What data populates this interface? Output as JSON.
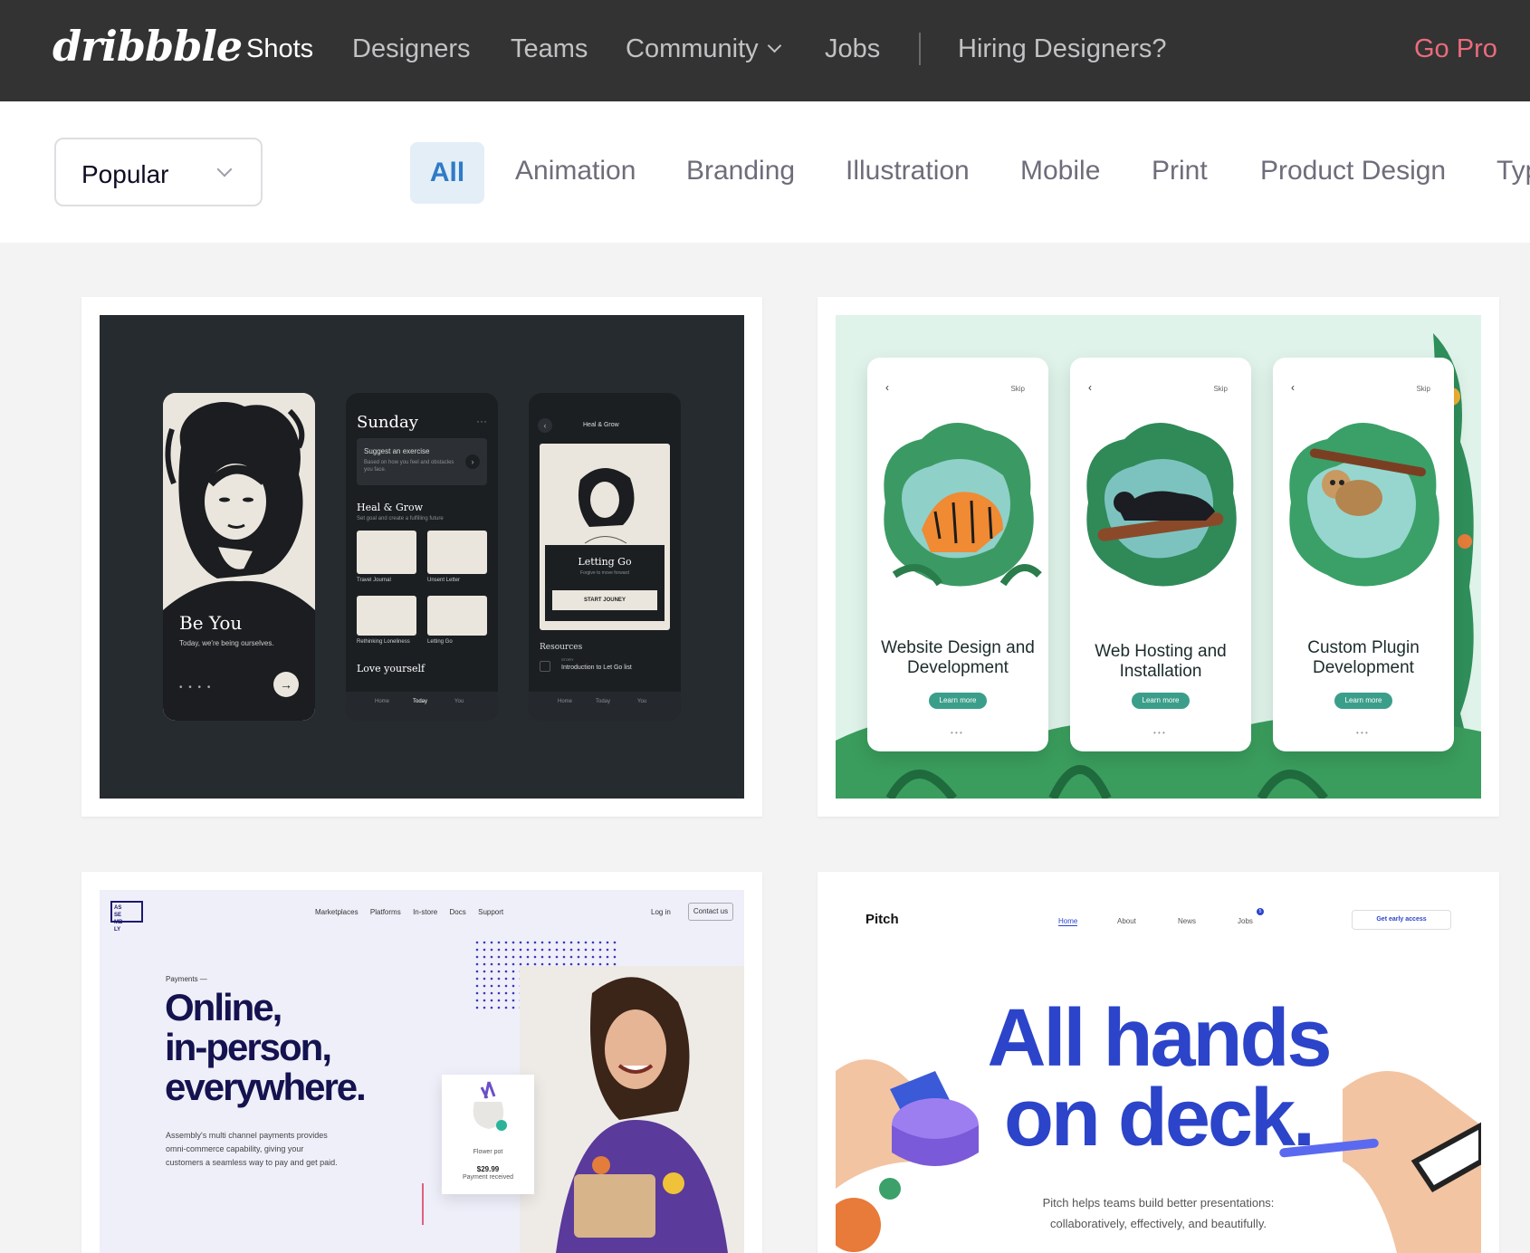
{
  "nav": {
    "logo": "dribbble",
    "links": [
      "Shots",
      "Designers",
      "Teams",
      "Community",
      "Jobs"
    ],
    "hiring": "Hiring Designers?",
    "go_pro": "Go Pro",
    "colors": {
      "background": "#333333",
      "go_pro": "#ea6c7c"
    }
  },
  "filter": {
    "sort": "Popular",
    "categories": [
      "All",
      "Animation",
      "Branding",
      "Illustration",
      "Mobile",
      "Print",
      "Product Design",
      "Typ"
    ],
    "active": "All"
  },
  "shots": [
    {
      "screens": {
        "be_you": {
          "title": "Be You",
          "subtitle": "Today, we're being ourselves."
        },
        "sunday": {
          "title": "Sunday",
          "card_title": "Suggest an exercise",
          "card_text": "Based on how you feel and obstacles you face.",
          "section": "Heal & Grow",
          "section_sub": "Set goal and create a fulfilling future",
          "items": [
            "Travel Journal",
            "Unsent Letter",
            "Rethinking Loneliness",
            "Letting Go"
          ],
          "footer_title": "Love yourself",
          "tabs": [
            "Home",
            "Today",
            "You"
          ]
        },
        "heal": {
          "header": "Heal & Grow",
          "card_title": "Letting Go",
          "card_sub": "Forgive to move forward",
          "button": "START JOUNEY",
          "resources": "Resources",
          "story": "STORY",
          "resource_item": "Introduction to Let Go list",
          "tabs": [
            "Home",
            "Today",
            "You"
          ]
        }
      }
    },
    {
      "screens": [
        {
          "title": "Website Design and Development",
          "button": "Learn more",
          "skip": "Skip"
        },
        {
          "title": "Web Hosting and Installation",
          "button": "Learn more",
          "skip": "Skip"
        },
        {
          "title": "Custom Plugin Development",
          "button": "Learn more",
          "skip": "Skip"
        }
      ]
    },
    {
      "logo": "AS SE MB LY",
      "nav": [
        "Marketplaces",
        "Platforms",
        "In-store",
        "Docs",
        "Support"
      ],
      "login": "Log in",
      "contact": "Contact us",
      "eyebrow": "Payments —",
      "headline": [
        "Online,",
        "in-person,",
        "everywhere."
      ],
      "body": [
        "Assembly's multi channel payments provides",
        "omni-commerce capability, giving your",
        "customers a seamless way to pay and get paid."
      ],
      "product": "Flower pot",
      "price": "$29.99",
      "status": "Payment received"
    },
    {
      "logo": "Pitch",
      "nav": [
        "Home",
        "About",
        "News",
        "Jobs"
      ],
      "jobs_badge": "5",
      "cta": "Get early access",
      "headline": [
        "All hands",
        "on deck."
      ],
      "body": [
        "Pitch helps teams build better presentations:",
        "collaboratively, effectively, and beautifully."
      ],
      "accent": "#2b44c9"
    }
  ]
}
